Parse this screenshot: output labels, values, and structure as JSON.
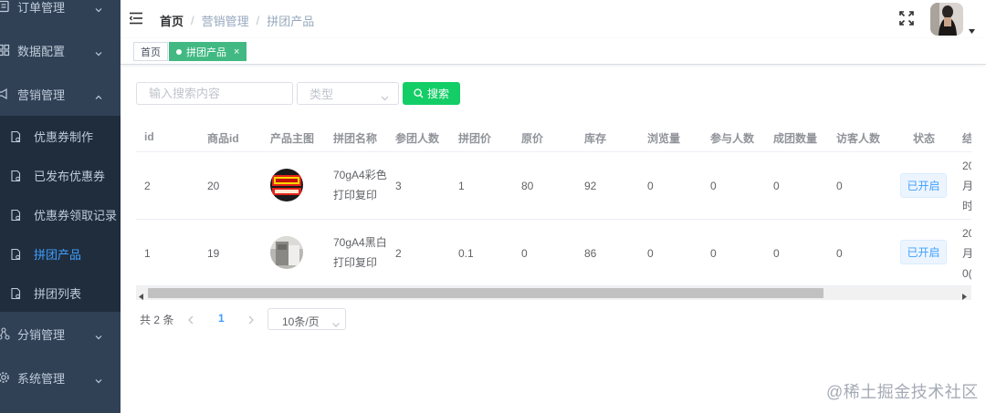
{
  "sidebar": {
    "menu": [
      {
        "label": "订单管理",
        "icon": "order-icon"
      },
      {
        "label": "数据配置",
        "icon": "data-config-icon"
      },
      {
        "label": "营销管理",
        "icon": "marketing-icon",
        "expanded": true
      },
      {
        "label": "分销管理",
        "icon": "distribution-icon"
      },
      {
        "label": "系统管理",
        "icon": "gear-icon"
      }
    ],
    "submenu": [
      {
        "label": "优惠券制作",
        "active": false
      },
      {
        "label": "已发布优惠券",
        "active": false
      },
      {
        "label": "优惠券领取记录",
        "active": false
      },
      {
        "label": "拼团产品",
        "active": true
      },
      {
        "label": "拼团列表",
        "active": false
      }
    ]
  },
  "header": {
    "breadcrumb": [
      "首页",
      "营销管理",
      "拼团产品"
    ]
  },
  "tags": [
    {
      "label": "首页",
      "active": false
    },
    {
      "label": "拼团产品",
      "active": true,
      "close": "×"
    }
  ],
  "search": {
    "placeholder": "输入搜索内容",
    "type_placeholder": "类型",
    "button_label": "搜索"
  },
  "table": {
    "columns": [
      "id",
      "商品id",
      "产品主图",
      "拼团名称",
      "参团人数",
      "拼团价",
      "原价",
      "库存",
      "浏览量",
      "参与人数",
      "成团数量",
      "访客人数",
      "状态",
      "结"
    ],
    "rows": [
      {
        "id": "2",
        "product_id": "20",
        "name": [
          "70gA4彩色",
          "打印复印"
        ],
        "group_size": "3",
        "group_price": "1",
        "original_price": "80",
        "stock": "92",
        "views": "0",
        "participants": "0",
        "groups_formed": "0",
        "visitors": "0",
        "status": "已开启",
        "clip": [
          "20",
          "月",
          "时"
        ]
      },
      {
        "id": "1",
        "product_id": "19",
        "name": [
          "70gA4黑白",
          "打印复印"
        ],
        "group_size": "2",
        "group_price": "0.1",
        "original_price": "0",
        "stock": "86",
        "views": "0",
        "participants": "0",
        "groups_formed": "0",
        "visitors": "0",
        "status": "已开启",
        "clip": [
          "20",
          "月",
          "0("
        ]
      }
    ]
  },
  "pagination": {
    "total": "共 2 条",
    "current": "1",
    "page_size": "10条/页"
  },
  "watermark": "@稀土掘金技术社区",
  "colors": {
    "sidebar_bg": "#304156",
    "submenu_bg": "#1f2d3d",
    "active": "#409eff",
    "tag_active": "#42b983",
    "search_button": "#13ce66"
  }
}
